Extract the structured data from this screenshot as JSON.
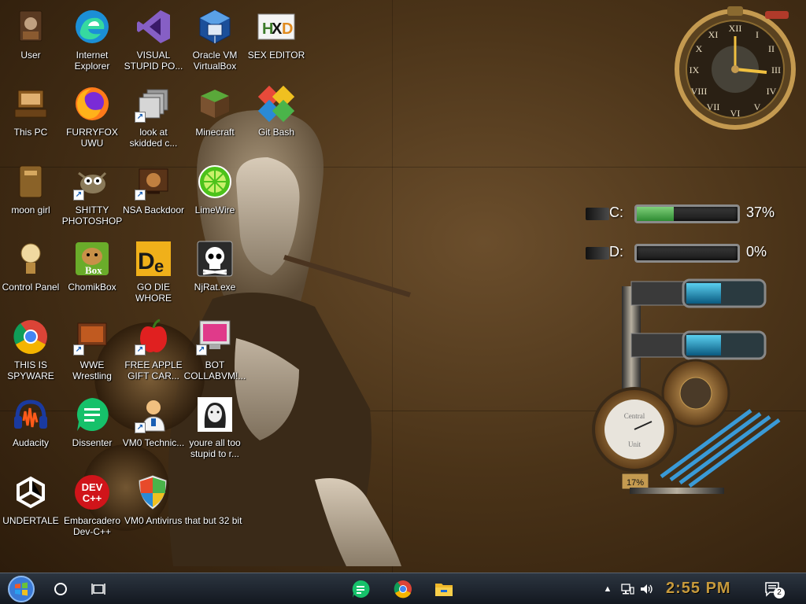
{
  "desktop": {
    "icons": [
      {
        "label": "User",
        "icon": "user-icon"
      },
      {
        "label": "Internet Explorer",
        "icon": "edge-icon"
      },
      {
        "label": "VISUAL STUPID PO...",
        "icon": "visual-studio-icon"
      },
      {
        "label": "Oracle VM VirtualBox",
        "icon": "virtualbox-icon"
      },
      {
        "label": "SEX EDITOR",
        "icon": "hxd-icon"
      },
      {
        "label": "This PC",
        "icon": "this-pc-icon"
      },
      {
        "label": "FURRYFOX UWU",
        "icon": "firefox-icon"
      },
      {
        "label": "look at skidded c...",
        "icon": "folder-copy-icon"
      },
      {
        "label": "Minecraft",
        "icon": "minecraft-icon"
      },
      {
        "label": "Git Bash",
        "icon": "git-bash-icon"
      },
      {
        "label": "moon girl",
        "icon": "folder-icon"
      },
      {
        "label": "SHITTY PHOTOSHOP",
        "icon": "gimp-icon"
      },
      {
        "label": "NSA Backdoor",
        "icon": "network-icon"
      },
      {
        "label": "LimeWire",
        "icon": "limewire-icon"
      },
      {
        "label": "Control Panel",
        "icon": "control-panel-icon"
      },
      {
        "label": "ChomikBox",
        "icon": "chomikbox-icon"
      },
      {
        "label": "GO DIE WHORE",
        "icon": "de-icon"
      },
      {
        "label": "NjRat.exe",
        "icon": "skull-icon"
      },
      {
        "label": "THIS IS SPYWARE",
        "icon": "chrome-icon"
      },
      {
        "label": "WWE Wrestling",
        "icon": "tv-icon"
      },
      {
        "label": "FREE APPLE GIFT CAR...",
        "icon": "apple-icon"
      },
      {
        "label": "BOT COLLABVM!...",
        "icon": "monitor-icon"
      },
      {
        "label": "Audacity",
        "icon": "audacity-icon"
      },
      {
        "label": "Dissenter",
        "icon": "dissenter-icon"
      },
      {
        "label": "VM0 Technic...",
        "icon": "technician-icon"
      },
      {
        "label": "youre all too stupid to r...",
        "icon": "portrait-icon"
      },
      {
        "label": "UNDERTALE",
        "icon": "unity-icon"
      },
      {
        "label": "Embarcadero Dev-C++",
        "icon": "devcpp-icon"
      },
      {
        "label": "VM0 Antivirus that but 32 bit",
        "icon": "shield-icon"
      }
    ]
  },
  "widgets": {
    "drive_c": {
      "letter": "C:",
      "percent_text": "37%",
      "percent": 37
    },
    "drive_d": {
      "letter": "D:",
      "percent_text": "0%",
      "percent": 0
    },
    "gauge_text": "17%",
    "gauge_label_top": "Central",
    "gauge_label_bottom": "Unit"
  },
  "taskbar": {
    "clock": "2:55 PM",
    "notification_count": "2",
    "pinned": [
      {
        "name": "dissenter",
        "icon": "dissenter-icon"
      },
      {
        "name": "chrome",
        "icon": "chrome-icon"
      },
      {
        "name": "file-explorer",
        "icon": "file-explorer-icon"
      }
    ]
  },
  "colors": {
    "taskbar_bg": "#1b222b",
    "clock_text": "#c79a3c",
    "drive_fill": "#4caf50"
  }
}
